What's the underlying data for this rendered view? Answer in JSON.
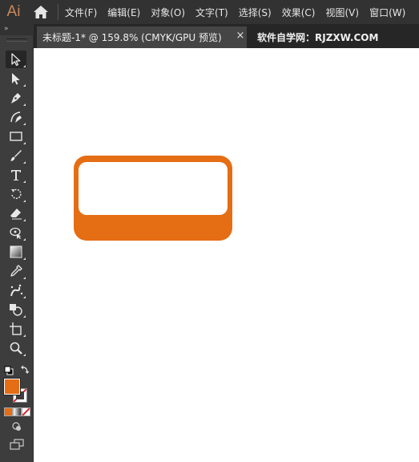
{
  "app": {
    "logo": "Ai"
  },
  "menubar": {
    "items": [
      "文件(F)",
      "编辑(E)",
      "对象(O)",
      "文字(T)",
      "选择(S)",
      "效果(C)",
      "视图(V)",
      "窗口(W)"
    ]
  },
  "tabs": {
    "active_label": "未标题-1* @ 159.8% (CMYK/GPU 预览)",
    "close_glyph": "×",
    "right_label": "软件自学网：RJZXW.COM"
  },
  "toolbar": {
    "collapse_glyph": "»",
    "tools": [
      {
        "name": "selection-tool",
        "icon": "arrow-icon",
        "selected": true
      },
      {
        "name": "direct-selection-tool",
        "icon": "direct-arrow-icon"
      },
      {
        "name": "pen-tool",
        "icon": "pen-icon"
      },
      {
        "name": "curvature-tool",
        "icon": "curvature-icon"
      },
      {
        "name": "rectangle-tool",
        "icon": "rectangle-icon"
      },
      {
        "name": "paintbrush-tool",
        "icon": "brush-icon"
      },
      {
        "name": "type-tool",
        "icon": "type-icon"
      },
      {
        "name": "rotate-tool",
        "icon": "rotate-icon"
      },
      {
        "name": "eraser-tool",
        "icon": "eraser-icon"
      },
      {
        "name": "puppet-warp-tool",
        "icon": "puppet-warp-icon"
      },
      {
        "name": "gradient-tool",
        "icon": "gradient-icon"
      },
      {
        "name": "eyedropper-tool",
        "icon": "eyedropper-icon"
      },
      {
        "name": "symbol-sprayer-tool",
        "icon": "sprayer-icon"
      },
      {
        "name": "shape-builder-tool",
        "icon": "shape-builder-icon"
      },
      {
        "name": "artboard-tool",
        "icon": "artboard-icon"
      },
      {
        "name": "zoom-tool",
        "icon": "magnifier-icon"
      }
    ]
  },
  "colors": {
    "fill": "#e56d14",
    "stroke": "none",
    "shape": "#e56d14",
    "ui_dark": "#323232",
    "toolbar": "#3d3d3d"
  }
}
